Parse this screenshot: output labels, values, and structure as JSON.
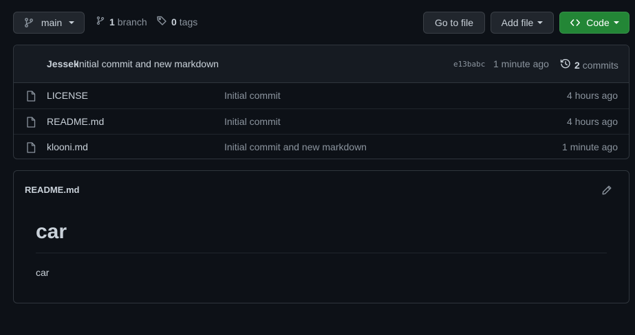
{
  "toolbar": {
    "branch_label": "main",
    "branches_count": "1",
    "branches_label": "branch",
    "tags_count": "0",
    "tags_label": "tags",
    "go_to_file": "Go to file",
    "add_file": "Add file",
    "code": "Code"
  },
  "latest_commit": {
    "author": "Jessek",
    "message": "Initial commit and new markdown",
    "sha": "e13babc",
    "time": "1 minute ago",
    "commits_count": "2",
    "commits_label": "commits"
  },
  "files": [
    {
      "name": "LICENSE",
      "message": "Initial commit",
      "age": "4 hours ago"
    },
    {
      "name": "README.md",
      "message": "Initial commit",
      "age": "4 hours ago"
    },
    {
      "name": "klooni.md",
      "message": "Initial commit and new markdown",
      "age": "1 minute ago"
    }
  ],
  "readme": {
    "filename": "README.md",
    "heading": "car",
    "body": "car"
  },
  "colors": {
    "background": "#0d1117",
    "code_button": "#238636",
    "border": "#30363d"
  }
}
